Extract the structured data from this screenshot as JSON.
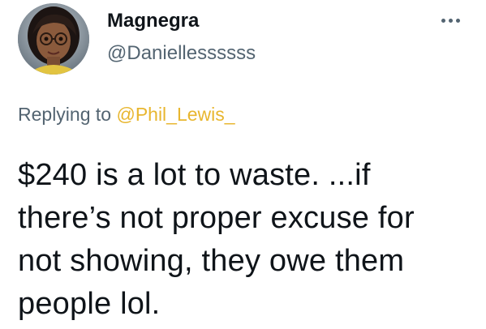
{
  "author": {
    "display_name": "Magnegra",
    "handle": "@Daniellessssss",
    "avatar_icon": "profile-avatar"
  },
  "menu": {
    "icon": "more-options-icon"
  },
  "reply": {
    "prefix": "Replying to ",
    "mention": "@Phil_Lewis_"
  },
  "tweet": {
    "lines": [
      "$240 is a lot to waste. ...if",
      "there’s not proper excuse for",
      "not showing, they owe them",
      "people lol."
    ]
  },
  "colors": {
    "text": "#0f1419",
    "secondary": "#536471",
    "mention": "#e8b62f",
    "background": "#ffffff"
  }
}
